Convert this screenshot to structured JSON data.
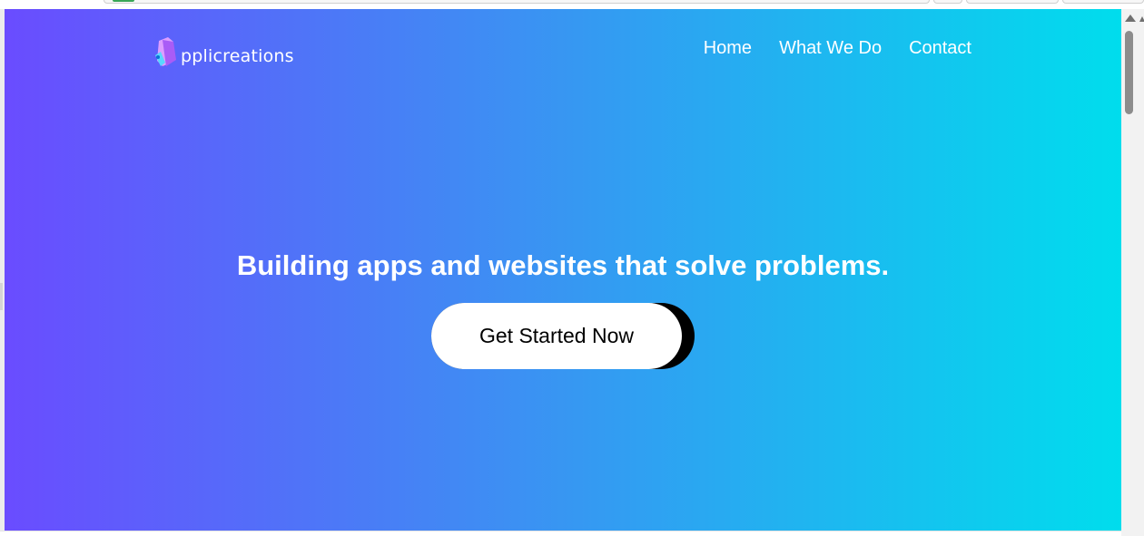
{
  "brand": {
    "logo_text": "pplicreations",
    "logo_icon": "cube-app-icon"
  },
  "nav": {
    "items": [
      {
        "label": "Home"
      },
      {
        "label": "What We Do"
      },
      {
        "label": "Contact"
      }
    ]
  },
  "hero": {
    "headline": "Building apps and websites that solve problems.",
    "cta_label": "Get Started Now",
    "gradient": {
      "start": "#6a4cff",
      "mid": "#3d8ff3",
      "end": "#00dded"
    }
  },
  "colors": {
    "text": "#ffffff",
    "cta_background": "#ffffff",
    "cta_text": "#000000",
    "cta_shadow": "#000000"
  },
  "scrollbar": {
    "arrow_icon": "arrow-up-icon"
  }
}
